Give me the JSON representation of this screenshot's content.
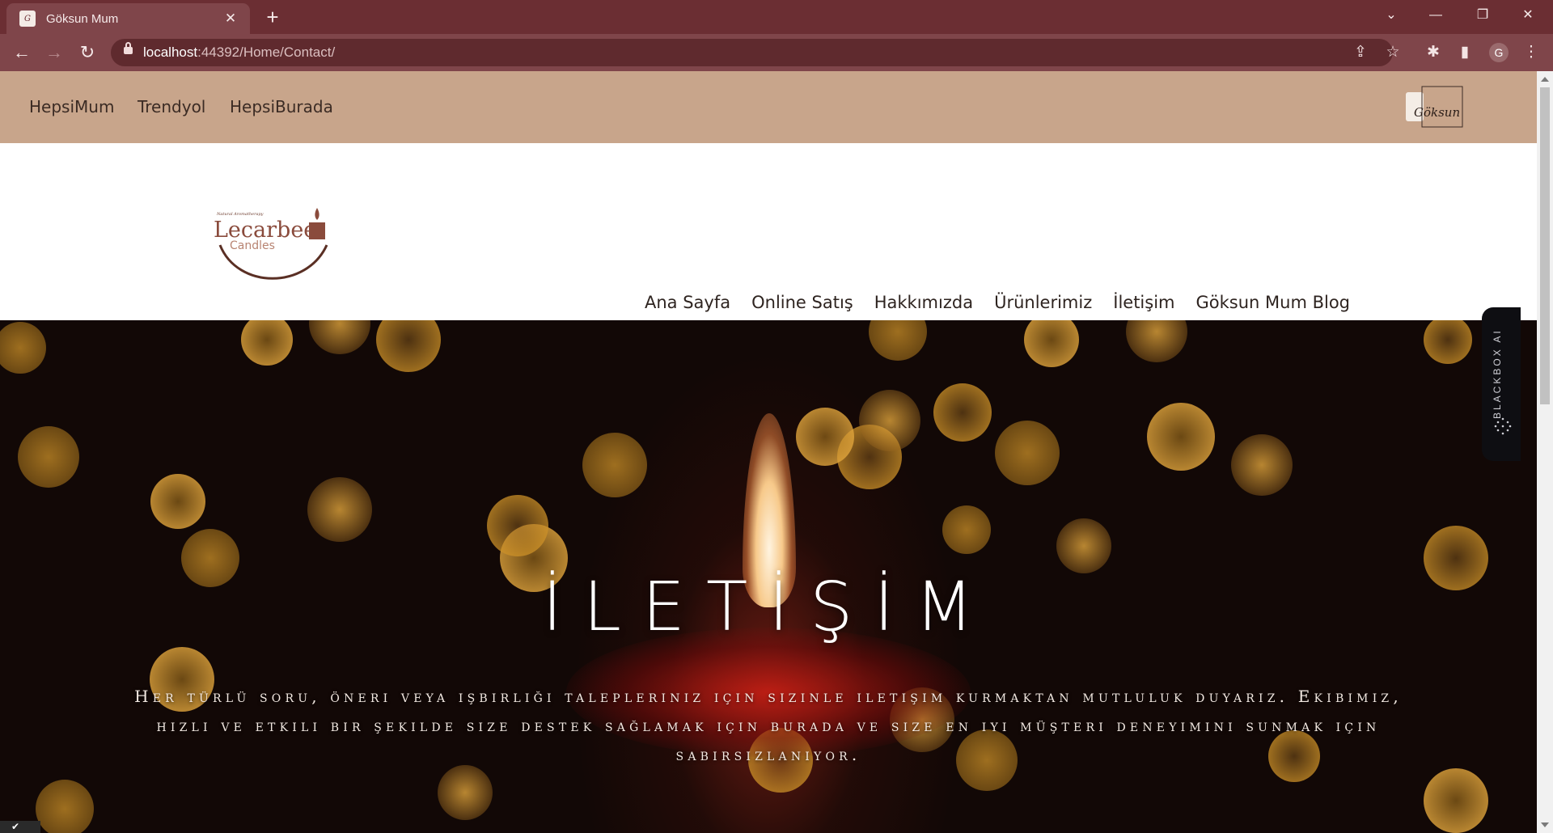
{
  "browser": {
    "tab": {
      "title": "Göksun Mum"
    },
    "url": {
      "host": "localhost",
      "path": ":44392/Home/Contact/"
    }
  },
  "topbar": {
    "links": [
      "HepsiMum",
      "Trendyol",
      "HepsiBurada"
    ],
    "logo_text": "Göksun"
  },
  "header": {
    "brand": {
      "small": "Natural Aromatherapy",
      "name": "Lecarbee",
      "sub": "Candles"
    },
    "menu": [
      "Ana Sayfa",
      "Online Satış",
      "Hakkımızda",
      "Ürünlerimiz",
      "İletişim",
      "Göksun Mum Blog"
    ]
  },
  "hero": {
    "title": "İLETİŞİM",
    "text": "Her türlü soru, öneri veya işbirliği talepleriniz için sizinle iletişim kurmaktan mutluluk duyarız. Ekibimiz, hızlı ve etkili bir şekilde size destek sağlamak için burada ve size en iyi müşteri deneyimini sunmak için sabırsızlanıyor."
  },
  "side_widget": {
    "label": "BLACKBOX AI"
  },
  "colors": {
    "chrome_dark": "#6b2e33",
    "chrome": "#7f454a",
    "topbar": "#c8a58b",
    "brand": "#8a4b3c"
  }
}
